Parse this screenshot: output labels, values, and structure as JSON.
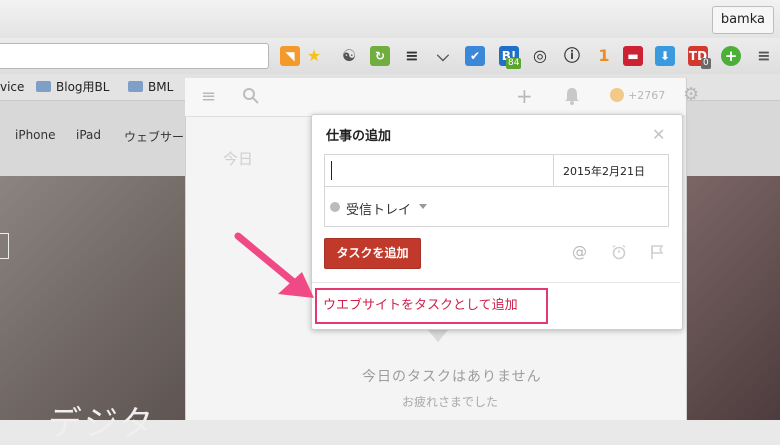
{
  "browser": {
    "profile_name": "bamka",
    "extensions": [
      {
        "name": "rss-icon",
        "color": "#f39a2b",
        "glyph": "◥"
      },
      {
        "name": "star-icon",
        "color": "#f4c21b",
        "glyph": "★"
      },
      {
        "name": "evernote-icon",
        "color": "#555555",
        "glyph": "☯"
      },
      {
        "name": "refresh-icon",
        "color": "#6fae3f",
        "glyph": "↻"
      },
      {
        "name": "buffer-icon",
        "color": "#333333",
        "glyph": "≡"
      },
      {
        "name": "pocket-icon",
        "color": "#555555",
        "glyph": "⌵"
      },
      {
        "name": "check-icon",
        "color": "#3b87d8",
        "glyph": "✔"
      },
      {
        "name": "hatena-icon",
        "color": "#1f71c7",
        "glyph": "B!"
      },
      {
        "name": "color-wheel-icon",
        "color": "#2b2b2b",
        "glyph": "◎"
      },
      {
        "name": "info-icon",
        "color": "#333333",
        "glyph": "ⓘ"
      },
      {
        "name": "one-icon",
        "color": "#f28b1e",
        "glyph": "1"
      },
      {
        "name": "mask-icon",
        "color": "#cc2233",
        "glyph": "▬"
      },
      {
        "name": "download-icon",
        "color": "#3a9ae0",
        "glyph": "⬇"
      },
      {
        "name": "todoist-icon",
        "color": "#d33a2f",
        "glyph": "TD"
      },
      {
        "name": "plus-circle-icon",
        "color": "#4caf3a",
        "glyph": "+"
      },
      {
        "name": "menu-icon",
        "color": "#555555",
        "glyph": "≡"
      }
    ],
    "badges": {
      "hatena": "84",
      "todoist": "0"
    },
    "bookmarks": [
      {
        "label": "vice"
      },
      {
        "label": "Blog用BL"
      },
      {
        "label": "BML"
      }
    ]
  },
  "page": {
    "nav": [
      "iPhone",
      "iPad",
      "ウェブサービ"
    ],
    "hero_text": "デジタ"
  },
  "app": {
    "karma": "2767",
    "today_faint": "今日",
    "empty_title": "今日のタスクはありません",
    "empty_sub": "お疲れさまでした"
  },
  "popup": {
    "title": "仕事の追加",
    "task_value": "",
    "due_date": "2015年2月21日",
    "project": "受信トレイ",
    "add_label": "タスクを追加",
    "website_link": "ウエブサイトをタスクとして追加"
  },
  "colors": {
    "accent": "#c0392b",
    "highlight": "#e2396e"
  }
}
